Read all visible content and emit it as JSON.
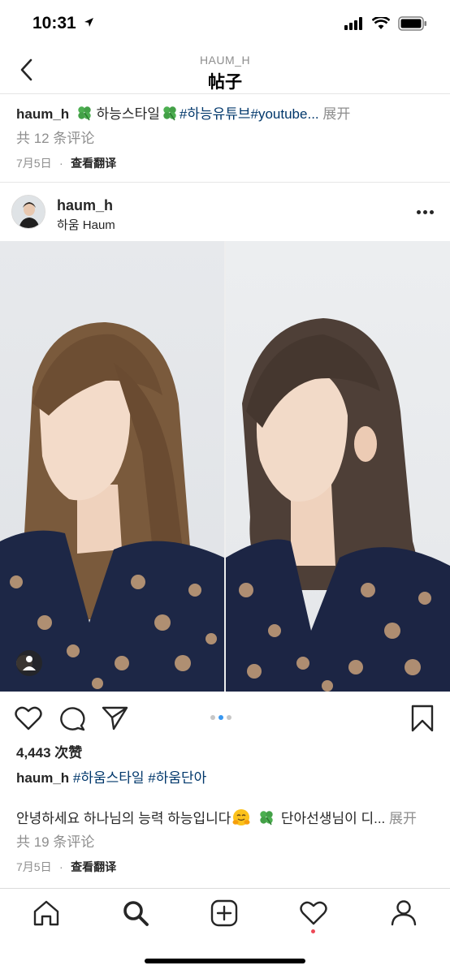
{
  "status_bar": {
    "time": "10:31"
  },
  "header": {
    "username": "HAUM_H",
    "title": "帖子"
  },
  "previous_post": {
    "username": "haum_h",
    "caption_text": "하능스타일",
    "hashtags": "#하능유튜브#youtube...",
    "more_label": "展开",
    "comments": "共 12 条评论",
    "date": "7月5日",
    "translate_label": "查看翻译"
  },
  "post": {
    "username": "haum_h",
    "subtitle": "하움 Haum",
    "likes": "4,443 次赞",
    "caption_user": "haum_h",
    "caption_tags": "#하움스타일 #하움단아",
    "body_text": "안녕하세요 하나님의 능력 하능입니다",
    "body_text_2": "단아선생님이 디...",
    "more_label": "展开",
    "comments": "共 19 条评论",
    "date": "7月5日",
    "translate_label": "查看翻译",
    "carousel": {
      "count": 3,
      "active_index": 1
    }
  },
  "icons": {
    "back": "chevron-left-icon",
    "more": "more-horizontal-icon",
    "like": "heart-icon",
    "comment": "comment-icon",
    "share": "send-icon",
    "save": "bookmark-icon",
    "nav": [
      "home-icon",
      "search-icon",
      "add-post-icon",
      "activity-heart-icon",
      "profile-icon"
    ]
  },
  "colors": {
    "hashtag": "#00376b",
    "muted": "#8e8e8e",
    "carousel_active": "#3897f0",
    "notification_dot": "#ed4956"
  }
}
